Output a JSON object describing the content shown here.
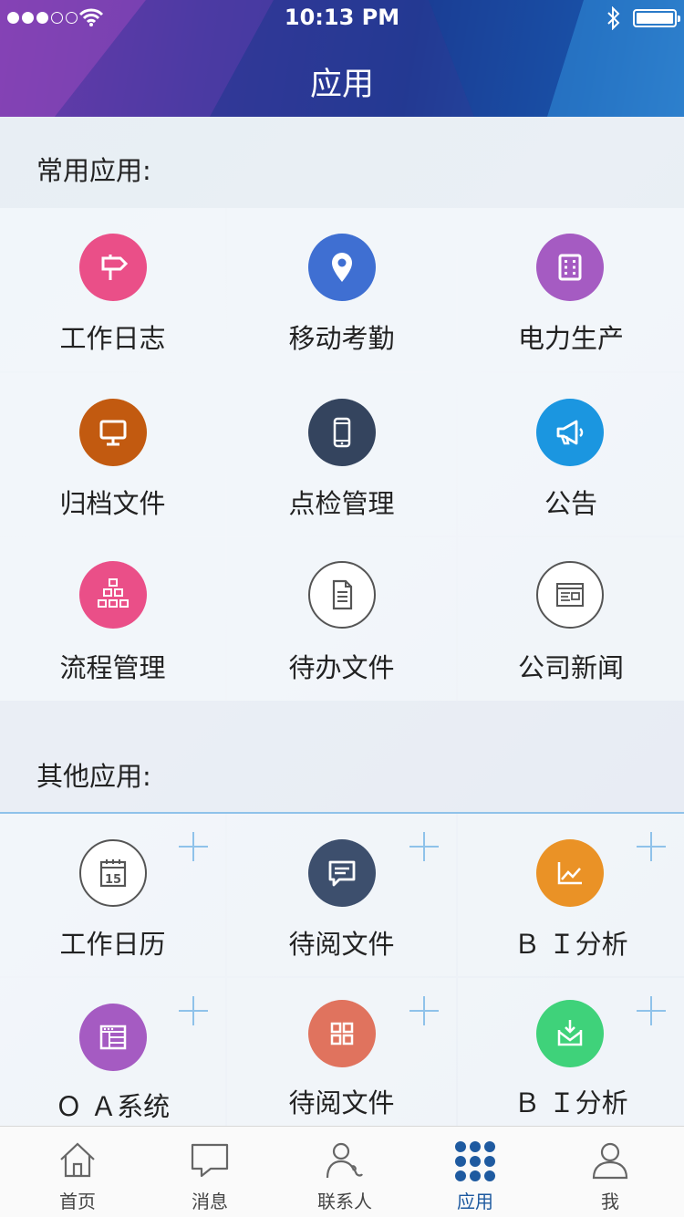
{
  "status_bar": {
    "time": "10:13 PM"
  },
  "header": {
    "title": "应用"
  },
  "common": {
    "heading": "常用应用:",
    "items": [
      {
        "label": "工作日志",
        "icon": "signpost-icon",
        "color": "#ea4f88"
      },
      {
        "label": "移动考勤",
        "icon": "location-pin-icon",
        "color": "#3f6fd2"
      },
      {
        "label": "电力生产",
        "icon": "film-strip-icon",
        "color": "#a55bc2"
      },
      {
        "label": "归档文件",
        "icon": "monitor-icon",
        "color": "#c25a10"
      },
      {
        "label": "点检管理",
        "icon": "phone-icon",
        "color": "#34445e"
      },
      {
        "label": "公告",
        "icon": "megaphone-icon",
        "color": "#1b96e0"
      },
      {
        "label": "流程管理",
        "icon": "hierarchy-icon",
        "color": "#ea4f88"
      },
      {
        "label": "待办文件",
        "icon": "document-icon",
        "color": "#ffffff"
      },
      {
        "label": "公司新闻",
        "icon": "browser-news-icon",
        "color": "#ffffff"
      }
    ]
  },
  "other": {
    "heading": "其他应用:",
    "items": [
      {
        "label": "工作日历",
        "icon": "calendar-icon",
        "color": "#ffffff",
        "day": "15"
      },
      {
        "label": "待阅文件",
        "icon": "chat-bubble-icon",
        "color": "#3d4f6d"
      },
      {
        "label": "Ｂ Ｉ分析",
        "icon": "line-chart-icon",
        "color": "#ea9226"
      },
      {
        "label": "Ｏ Ａ系统",
        "icon": "window-icon",
        "color": "#a55bc2"
      },
      {
        "label": "待阅文件",
        "icon": "grid-apps-icon",
        "color": "#e0735e"
      },
      {
        "label": "Ｂ Ｉ分析",
        "icon": "mail-download-icon",
        "color": "#3fd27a"
      }
    ]
  },
  "tabbar": {
    "tabs": [
      {
        "label": "首页",
        "icon": "home-icon"
      },
      {
        "label": "消息",
        "icon": "message-icon"
      },
      {
        "label": "联系人",
        "icon": "contacts-icon"
      },
      {
        "label": "应用",
        "icon": "apps-grid-icon",
        "active": true
      },
      {
        "label": "我",
        "icon": "user-icon"
      }
    ]
  },
  "accent_color": "#1e5aa0"
}
